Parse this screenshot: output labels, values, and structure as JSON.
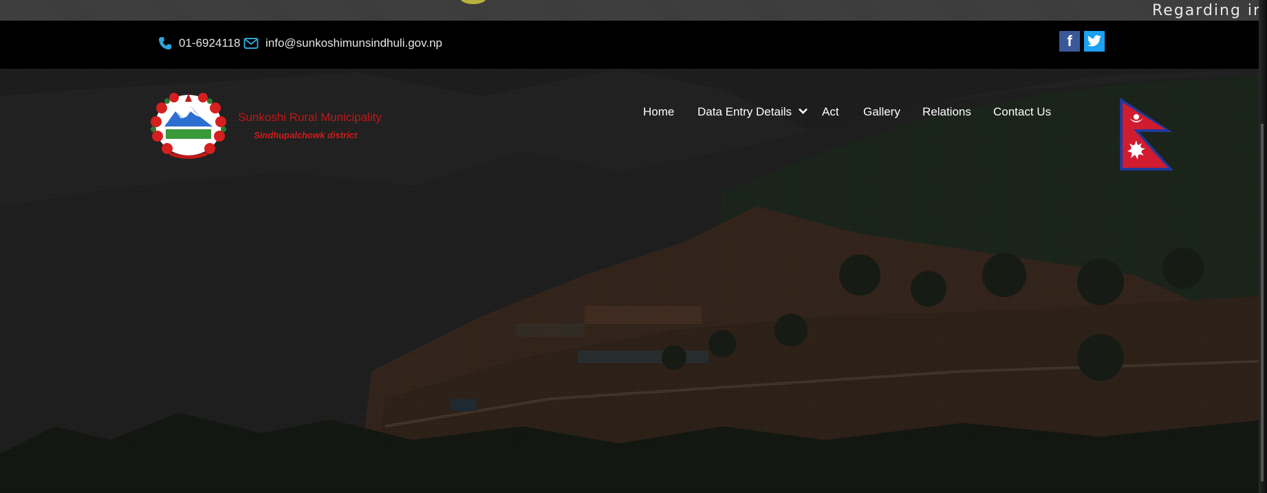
{
  "ticker": {
    "text": "Regarding infor"
  },
  "contact": {
    "phone": "01-6924118",
    "email": "info@sunkoshimunsindhuli.gov.np"
  },
  "social": {
    "facebook_label": "f"
  },
  "brand": {
    "title": "Sunkoshi Rural Municipality",
    "subtitle": "Sindhupalchowk district"
  },
  "nav": {
    "home": "Home",
    "data_entry": "Data Entry Details",
    "act": "Act",
    "gallery": "Gallery",
    "relations": "Relations",
    "contact": "Contact Us"
  },
  "icons": {
    "phone": "phone-icon",
    "email": "envelope-icon",
    "facebook": "facebook-icon",
    "twitter": "twitter-icon",
    "dropdown": "chevron-down-icon"
  },
  "colors": {
    "accent_icon": "#2ea6d8",
    "brand_red": "#c01818",
    "facebook": "#3b5998",
    "twitter": "#1da1f2"
  }
}
